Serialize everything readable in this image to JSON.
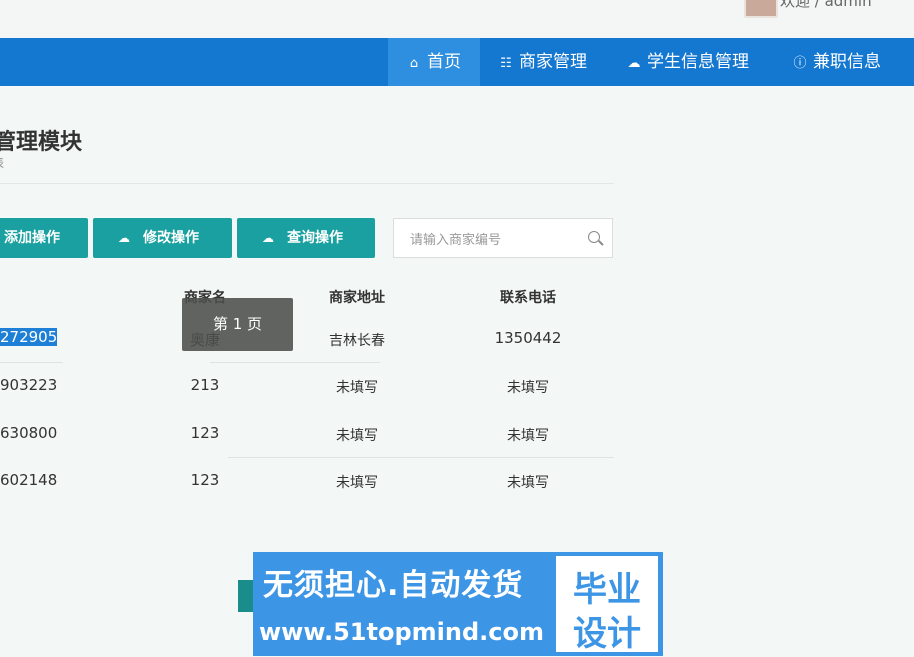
{
  "header": {
    "welcome": "欢迎 / admin"
  },
  "nav": {
    "items": [
      {
        "label": "首页",
        "icon": "home-icon"
      },
      {
        "label": "商家管理",
        "icon": "sitemap-icon"
      },
      {
        "label": "学生信息管理",
        "icon": "cloud-icon"
      },
      {
        "label": "兼职信息",
        "icon": "info-icon"
      }
    ],
    "active": "首页"
  },
  "page": {
    "title": "管理模块",
    "subtitle": "表"
  },
  "toolbar": {
    "add_label": "添加操作",
    "edit_label": "修改操作",
    "query_label": "查询操作",
    "button_color": "#1aa0a0"
  },
  "search": {
    "placeholder": "请输入商家编号",
    "value": ""
  },
  "table": {
    "columns": [
      "商家名",
      "商家地址",
      "联系电话"
    ],
    "rows": [
      {
        "id": "272905",
        "name": "奥康",
        "address": "吉林长春",
        "phone": "1350442"
      },
      {
        "id": "903223",
        "name": "213",
        "address": "未填写",
        "phone": "未填写"
      },
      {
        "id": "630800",
        "name": "123",
        "address": "未填写",
        "phone": "未填写"
      },
      {
        "id": "602148",
        "name": "123",
        "address": "未填写",
        "phone": "未填写"
      }
    ]
  },
  "tooltip": {
    "text": "第 1 页"
  },
  "watermark": {
    "line1": "无须担心.自动发货",
    "line2": "www.51topmind.com",
    "box_top": "毕业",
    "box_bottom": "设计",
    "color": "#3d95e6"
  },
  "colors": {
    "nav_bg": "#1477d0",
    "nav_active": "#2e8ee0",
    "selection": "#1e7fd6"
  }
}
